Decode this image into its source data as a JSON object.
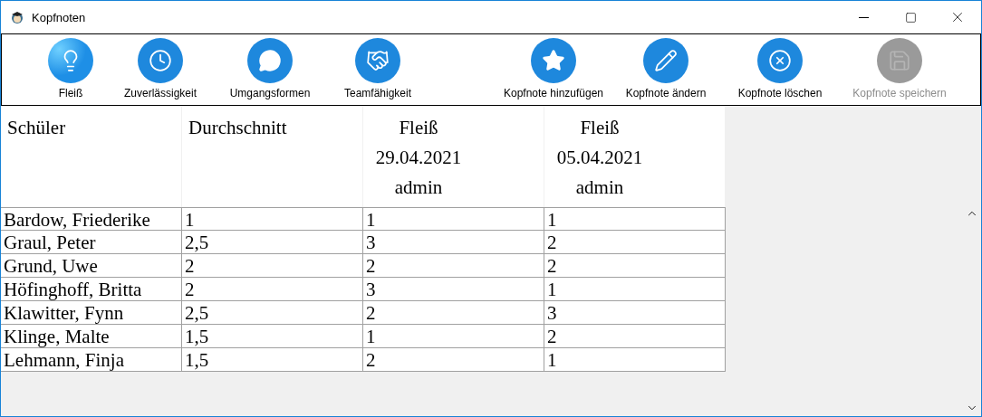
{
  "window": {
    "title": "Kopfnoten"
  },
  "toolbar": [
    {
      "label": "Fleiß",
      "kind": "category",
      "selected": true,
      "disabled": false
    },
    {
      "label": "Zuverlässigkeit",
      "kind": "category",
      "selected": false,
      "disabled": false
    },
    {
      "label": "Umgangsformen",
      "kind": "category",
      "selected": false,
      "disabled": false
    },
    {
      "label": "Teamfähigkeit",
      "kind": "category",
      "selected": false,
      "disabled": false
    },
    {
      "label": "Kopfnote hinzufügen",
      "kind": "action",
      "disabled": false
    },
    {
      "label": "Kopfnote ändern",
      "kind": "action",
      "disabled": false
    },
    {
      "label": "Kopfnote löschen",
      "kind": "action",
      "disabled": false
    },
    {
      "label": "Kopfnote speichern",
      "kind": "action",
      "disabled": true
    }
  ],
  "table": {
    "columns": [
      {
        "lines": [
          "Schüler"
        ]
      },
      {
        "lines": [
          "Durchschnitt"
        ]
      },
      {
        "lines": [
          "Fleiß",
          "29.04.2021",
          "admin"
        ]
      },
      {
        "lines": [
          "Fleiß",
          "05.04.2021",
          "admin"
        ]
      }
    ],
    "rows": [
      [
        "Bardow, Friederike",
        "1",
        "1",
        "1"
      ],
      [
        "Graul, Peter",
        "2,5",
        "3",
        "2"
      ],
      [
        "Grund, Uwe",
        "2",
        "2",
        "2"
      ],
      [
        "Höfinghoff, Britta",
        "2",
        "3",
        "1"
      ],
      [
        "Klawitter, Fynn",
        "2,5",
        "2",
        "3"
      ],
      [
        "Klinge, Malte",
        "1,5",
        "1",
        "2"
      ],
      [
        "Lehmann, Finja",
        "1,5",
        "2",
        "1"
      ]
    ]
  }
}
